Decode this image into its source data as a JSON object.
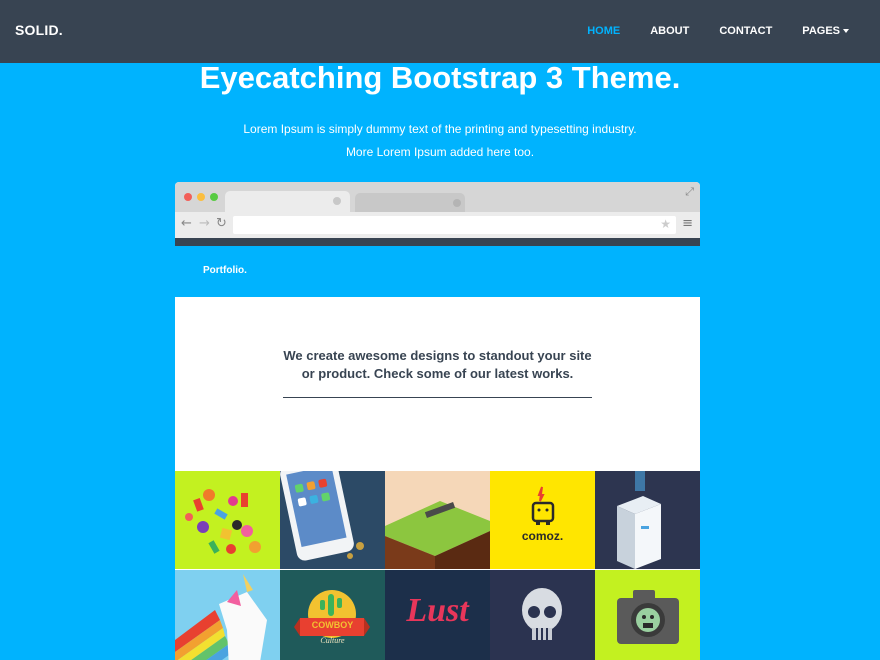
{
  "navbar": {
    "brand": "SOLID.",
    "links": [
      {
        "label": "HOME",
        "active": true
      },
      {
        "label": "ABOUT",
        "active": false
      },
      {
        "label": "CONTACT",
        "active": false
      },
      {
        "label": "PAGES",
        "active": false,
        "dropdown": true
      }
    ]
  },
  "hero": {
    "title": "Eyecatching Bootstrap 3 Theme.",
    "subtitle_line1": "Lorem Ipsum is simply dummy text of the printing and typesetting industry.",
    "subtitle_line2": "More Lorem Ipsum added here too."
  },
  "mockup": {
    "inner_brand": "Portfolio.",
    "inner_text_line1": "We create awesome designs to standout your site",
    "inner_text_line2": "or product. Check some of our latest works.",
    "tiles": [
      {
        "name": "candy-tile",
        "bg": "#c3f120"
      },
      {
        "name": "phone-tile",
        "bg": "#2c4a66"
      },
      {
        "name": "hammock-tile",
        "bg": "#f5d7b8"
      },
      {
        "name": "comoz-tile",
        "bg": "#ffe600",
        "label": "comoz."
      },
      {
        "name": "fridge-tile",
        "bg": "#2d3550"
      },
      {
        "name": "unicorn-tile",
        "bg": "#7fd0f0"
      },
      {
        "name": "cowboy-tile",
        "bg": "#1f5a5a",
        "label_line1": "COWBOY",
        "label_line2": "Culture"
      },
      {
        "name": "lust-tile",
        "bg": "#1c2f4a",
        "label": "Lust"
      },
      {
        "name": "skull-tile",
        "bg": "#2b3350"
      },
      {
        "name": "camera-tile",
        "bg": "#c3f120"
      }
    ]
  },
  "colors": {
    "accent": "#00b3fe",
    "navbar": "#384452"
  }
}
